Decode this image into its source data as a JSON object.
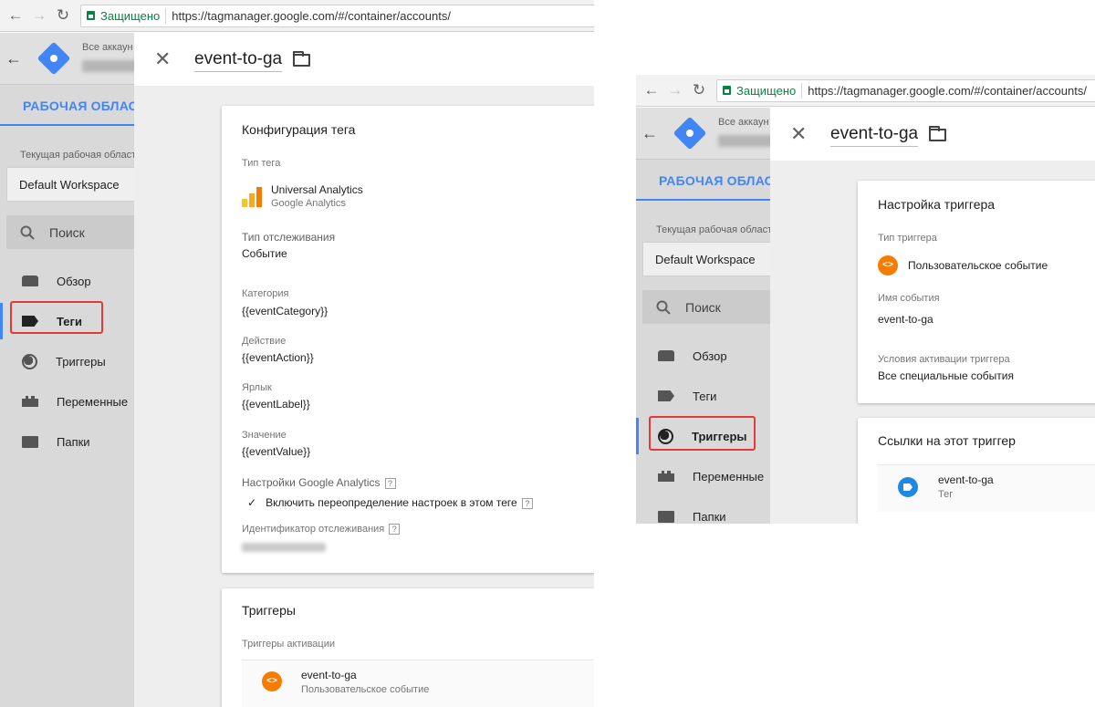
{
  "left": {
    "browser": {
      "secure_label": "Защищено",
      "url": "https://tagmanager.google.com/#/container/accounts/"
    },
    "header": {
      "account_label": "Все аккаун"
    },
    "workspace_tab": "РАБОЧАЯ ОБЛАСТЬ",
    "current_workspace_label": "Текущая рабочая област",
    "workspace_name": "Default Workspace",
    "search_placeholder": "Поиск",
    "nav": [
      "Обзор",
      "Теги",
      "Триггеры",
      "Переменные",
      "Папки"
    ],
    "panel": {
      "title": "event-to-ga",
      "config_card": {
        "title": "Конфигурация тега",
        "tag_type_label": "Тип тега",
        "tag_type_name": "Universal Analytics",
        "tag_type_sub": "Google Analytics",
        "track_type_label": "Тип отслеживания",
        "track_type_value": "Событие",
        "category_label": "Категория",
        "category_value": "{{eventCategory}}",
        "action_label": "Действие",
        "action_value": "{{eventAction}}",
        "label_label": "Ярлык",
        "label_value": "{{eventLabel}}",
        "value_label": "Значение",
        "value_value": "{{eventValue}}",
        "ga_settings_label": "Настройки Google Analytics",
        "override_label": "Включить переопределение настроек в этом теге",
        "tracking_id_label": "Идентификатор отслеживания"
      },
      "triggers_card": {
        "title": "Триггеры",
        "firing_label": "Триггеры активации",
        "trigger_name": "event-to-ga",
        "trigger_type": "Пользовательское событие"
      }
    }
  },
  "right": {
    "browser": {
      "secure_label": "Защищено",
      "url": "https://tagmanager.google.com/#/container/accounts/"
    },
    "header": {
      "account_label": "Все аккаун"
    },
    "workspace_tab": "РАБОЧАЯ ОБЛАСТЬ",
    "current_workspace_label": "Текущая рабочая област",
    "workspace_name": "Default Workspace",
    "search_placeholder": "Поиск",
    "nav": [
      "Обзор",
      "Теги",
      "Триггеры",
      "Переменные",
      "Папки"
    ],
    "panel": {
      "title": "event-to-ga",
      "trigger_card": {
        "title": "Настройка триггера",
        "type_label": "Тип триггера",
        "type_value": "Пользовательское событие",
        "event_name_label": "Имя события",
        "event_name_value": "event-to-ga",
        "conditions_label": "Условия активации триггера",
        "conditions_value": "Все специальные события"
      },
      "refs_card": {
        "title": "Ссылки на этот триггер",
        "ref_name": "event-to-ga",
        "ref_type": "Тег"
      }
    }
  },
  "colors": {
    "accent": "#4285f4",
    "highlight": "#e53935",
    "trigger": "#f57c00",
    "tag": "#1e88e5"
  }
}
